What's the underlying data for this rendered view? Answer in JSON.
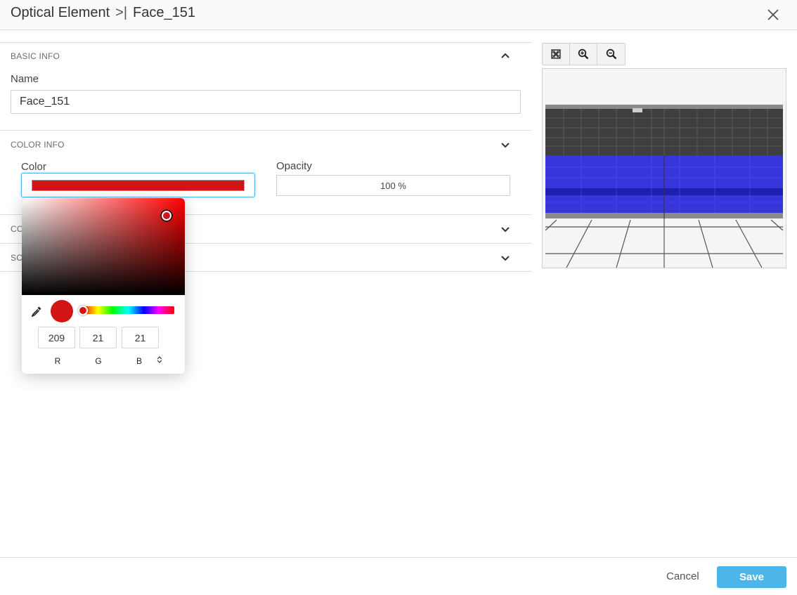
{
  "header": {
    "breadcrumb_parent": "Optical Element",
    "breadcrumb_separator": ">|",
    "breadcrumb_current": "Face_151",
    "close_icon": "close-icon"
  },
  "basic_info": {
    "title": "BASIC INFO",
    "name_label": "Name",
    "name_value": "Face_151"
  },
  "color_info": {
    "title": "COLOR INFO",
    "color_label": "Color",
    "color_hex": "#d11515",
    "opacity_label": "Opacity",
    "opacity_value": "100 %"
  },
  "collapsed_sections": {
    "third_prefix": "CO",
    "fourth_prefix": "SC"
  },
  "color_picker": {
    "r": "209",
    "g": "21",
    "b": "21",
    "r_label": "R",
    "g_label": "G",
    "b_label": "B",
    "mode_toggle_icon": "up-down-icon",
    "eyedropper_icon": "eyedropper-icon"
  },
  "viewer": {
    "tools": [
      "fit-view-icon",
      "zoom-in-icon",
      "zoom-out-icon"
    ],
    "surface_color": "#2b2bd9"
  },
  "footer": {
    "cancel_label": "Cancel",
    "save_label": "Save"
  }
}
